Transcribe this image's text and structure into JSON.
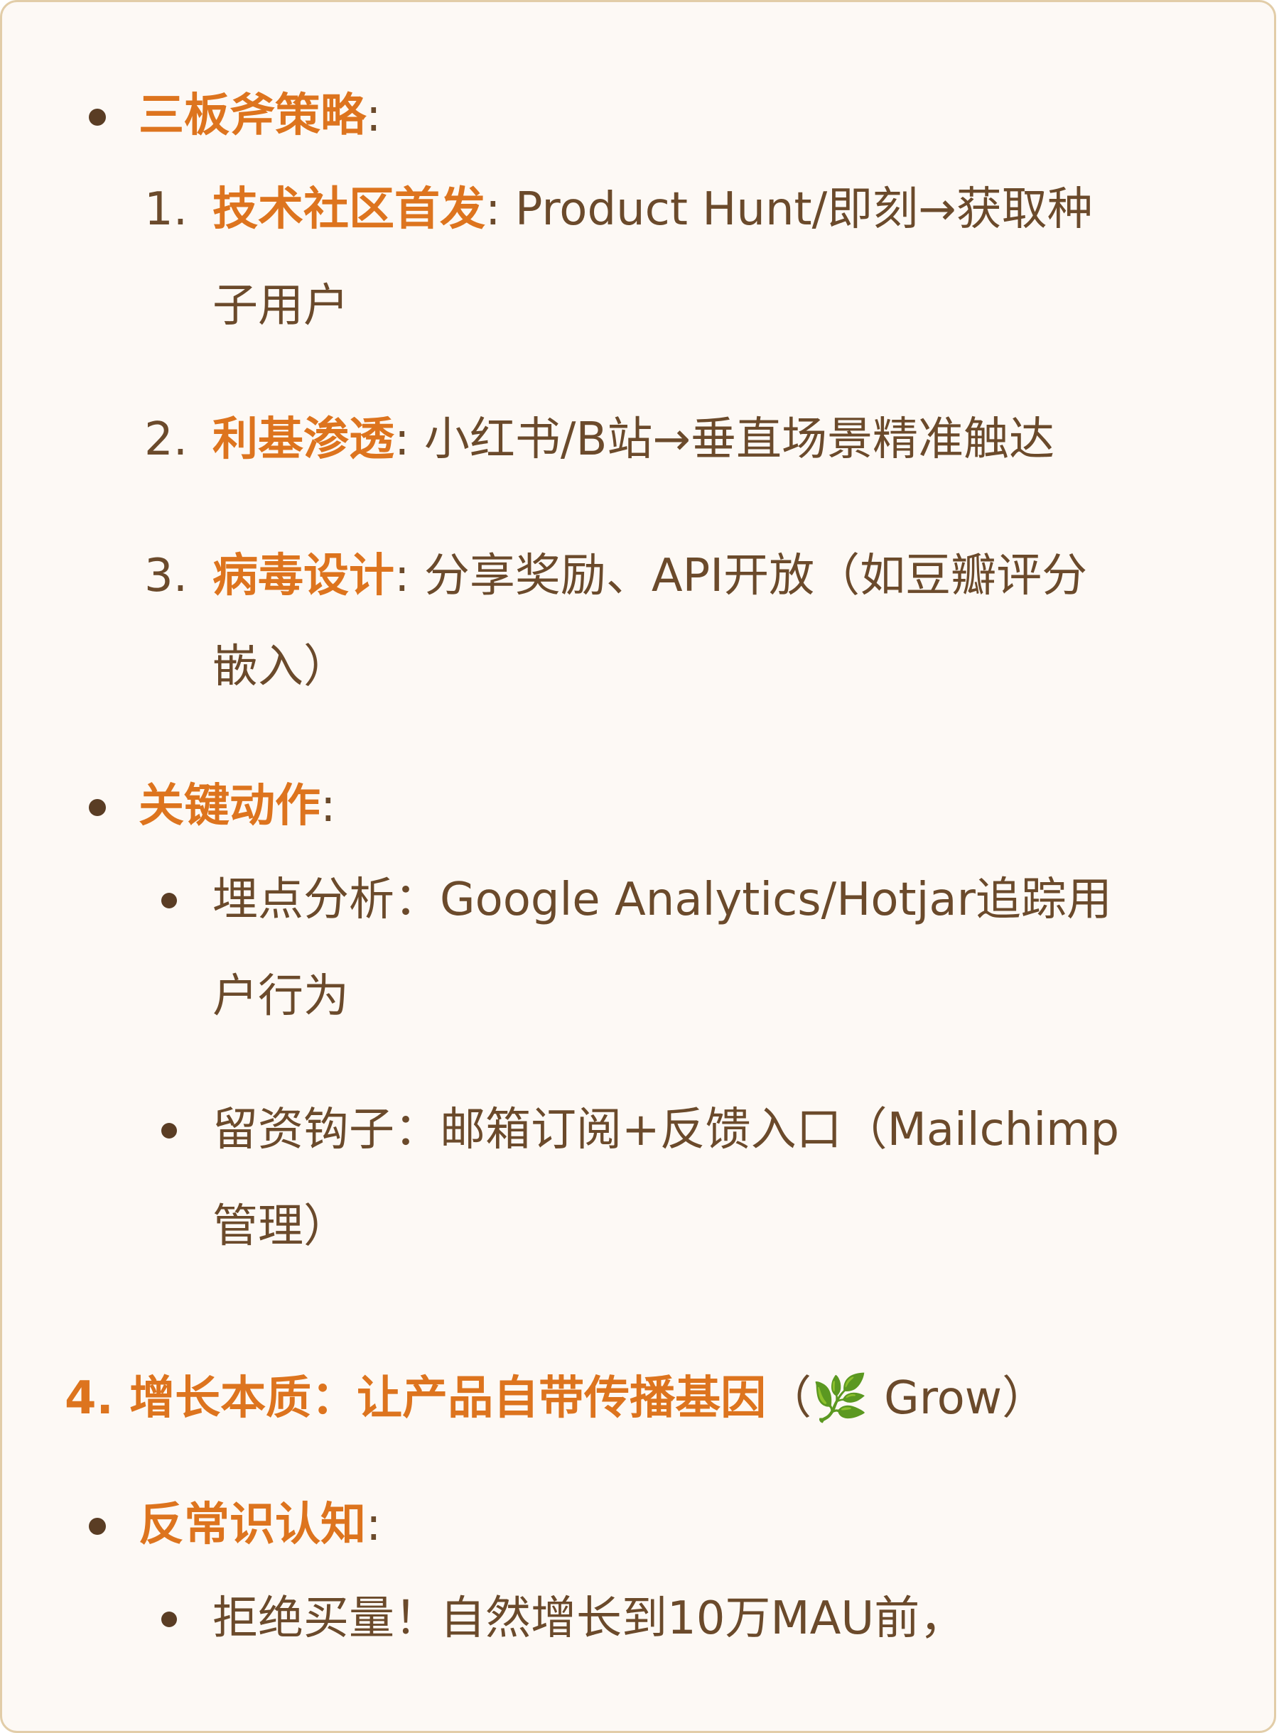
{
  "section1": {
    "heading": "三板斧策略",
    "heading_colon": ":",
    "items": [
      {
        "number": "1.",
        "title": "技术社区首发",
        "sep": ":",
        "text_line1": "Product Hunt/即刻→获取种",
        "text_line2": "子用户"
      },
      {
        "number": "2.",
        "title": "利基渗透",
        "sep": ":",
        "text_line1": "小红书/B站→垂直场景精准触达"
      },
      {
        "number": "3.",
        "title": "病毒设计",
        "sep": ":",
        "text_line1": "分享奖励、API开放（如豆瓣评分",
        "text_line2": "嵌入）"
      }
    ]
  },
  "section2": {
    "heading": "关键动作",
    "heading_colon": ":",
    "items": [
      {
        "text_line1": "埋点分析：Google Analytics/Hotjar追踪用",
        "text_line2": "户行为"
      },
      {
        "text_line1": "留资钩子：邮箱订阅+反馈入口（Mailchimp",
        "text_line2": "管理）"
      }
    ]
  },
  "heading4": {
    "number": "4.",
    "title": "增长本质：让产品自带传播基因",
    "paren_open": "（",
    "emoji": "🌿",
    "tag": "Grow",
    "paren_close": "）"
  },
  "section3": {
    "heading": "反常识认知",
    "heading_colon": ":",
    "items": [
      {
        "text_line1": "拒绝买量！自然增长到10万MAU前，"
      }
    ]
  },
  "colors": {
    "accent": "#dd741e",
    "text": "#6b4a2b",
    "background": "#fdf9f5",
    "border": "#e2cda8"
  }
}
